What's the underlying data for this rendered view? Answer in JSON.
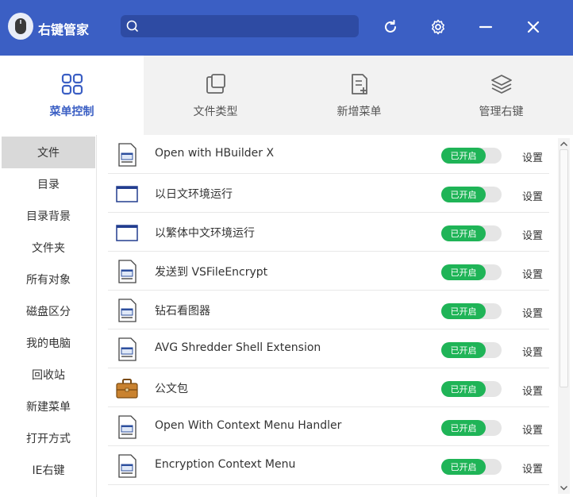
{
  "app": {
    "title": "右键管家",
    "logo_icon": "mouse-icon",
    "accent": "#3b5fc4"
  },
  "search": {
    "value": "",
    "placeholder": ""
  },
  "titlebar_buttons": [
    {
      "name": "refresh-icon"
    },
    {
      "name": "gear-icon"
    },
    {
      "name": "minimize-icon"
    },
    {
      "name": "close-icon"
    }
  ],
  "tabs": [
    {
      "label": "菜单控制",
      "icon": "grid-icon",
      "active": true
    },
    {
      "label": "文件类型",
      "icon": "file-type-icon",
      "active": false
    },
    {
      "label": "新增菜单",
      "icon": "new-menu-icon",
      "active": false
    },
    {
      "label": "管理右键",
      "icon": "layers-icon",
      "active": false
    }
  ],
  "sidebar": {
    "items": [
      {
        "label": "文件",
        "active": true
      },
      {
        "label": "目录"
      },
      {
        "label": "目录背景"
      },
      {
        "label": "文件夹"
      },
      {
        "label": "所有对象"
      },
      {
        "label": "磁盘区分"
      },
      {
        "label": "我的电脑"
      },
      {
        "label": "回收站"
      },
      {
        "label": "新建菜单"
      },
      {
        "label": "打开方式"
      },
      {
        "label": "IE右键"
      }
    ]
  },
  "list": {
    "status_color": "#1fb457",
    "items": [
      {
        "name": "Open with HBuilder X",
        "icon": "document-icon",
        "status": "已开启",
        "action": "设置"
      },
      {
        "name": "以日文环境运行",
        "icon": "window-icon",
        "status": "已开启",
        "action": "设置"
      },
      {
        "name": "以繁体中文环境运行",
        "icon": "window-icon",
        "status": "已开启",
        "action": "设置"
      },
      {
        "name": "发送到 VSFileEncrypt",
        "icon": "document-icon",
        "status": "已开启",
        "action": "设置"
      },
      {
        "name": "钻石看图器",
        "icon": "document-icon",
        "status": "已开启",
        "action": "设置"
      },
      {
        "name": "AVG Shredder Shell Extension",
        "icon": "document-icon",
        "status": "已开启",
        "action": "设置"
      },
      {
        "name": "公文包",
        "icon": "briefcase-icon",
        "status": "已开启",
        "action": "设置"
      },
      {
        "name": "Open With Context Menu Handler",
        "icon": "document-icon",
        "status": "已开启",
        "action": "设置"
      },
      {
        "name": "Encryption Context Menu",
        "icon": "document-icon",
        "status": "已开启",
        "action": "设置"
      }
    ]
  }
}
